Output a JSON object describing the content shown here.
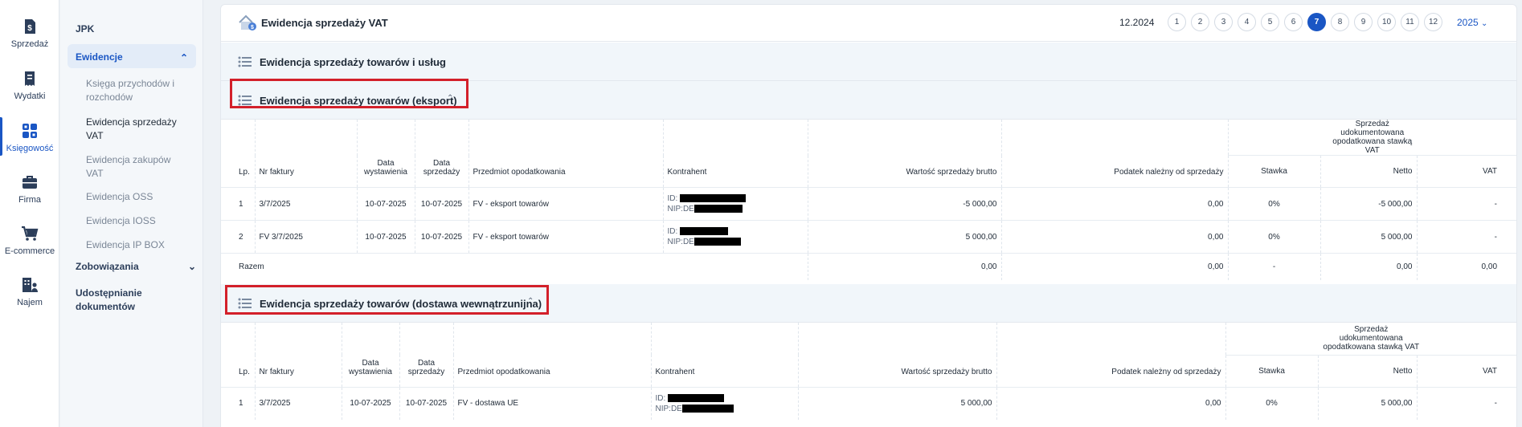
{
  "rail": {
    "items": [
      {
        "label": "Sprzedaż",
        "icon": "dollar-document-icon"
      },
      {
        "label": "Wydatki",
        "icon": "receipt-icon"
      },
      {
        "label": "Księgowość",
        "icon": "grid-icon"
      },
      {
        "label": "Firma",
        "icon": "briefcase-icon"
      },
      {
        "label": "E-commerce",
        "icon": "cart-icon"
      },
      {
        "label": "Najem",
        "icon": "building-user-icon"
      }
    ]
  },
  "subnav": {
    "jpk": "JPK",
    "ewidencje": "Ewidencje",
    "children": [
      "Księga przychodów i rozchodów",
      "Ewidencja sprzedaży VAT",
      "Ewidencja zakupów VAT",
      "Ewidencja OSS",
      "Ewidencja IOSS",
      "Ewidencja IP BOX"
    ],
    "zobowiazania": "Zobowiązania",
    "udostepnianie": "Udostępnianie dokumentów"
  },
  "header": {
    "title": "Ewidencja sprzedaży VAT",
    "period": "12.2024",
    "months": [
      "1",
      "2",
      "3",
      "4",
      "5",
      "6",
      "7",
      "8",
      "9",
      "10",
      "11",
      "12"
    ],
    "selected_month": "7",
    "year": "2025"
  },
  "sections": {
    "s1": {
      "title": "Ewidencja sprzedaży towarów i usług"
    },
    "s2": {
      "title": "Ewidencja sprzedaży towarów (eksport)"
    },
    "s3": {
      "title": "Ewidencja sprzedaży towarów (dostawa wewnątrzunijna)"
    }
  },
  "columns": {
    "lp": "Lp.",
    "nr": "Nr faktury",
    "data_wyst": "Data wystawienia",
    "data_sprz": "Data sprzedaży",
    "przedmiot": "Przedmiot opodatkowania",
    "kontrahent": "Kontrahent",
    "brutto": "Wartość sprzedaży brutto",
    "podatek": "Podatek należny od sprzedaży",
    "group": "Sprzedaż udokumentowana opodatkowana stawką VAT",
    "stawka": "Stawka",
    "netto": "Netto",
    "vat": "VAT"
  },
  "export_rows": [
    {
      "lp": "1",
      "nr": "3/7/2025",
      "data_wyst": "10-07-2025",
      "data_sprz": "10-07-2025",
      "przedmiot": "FV - eksport towarów",
      "id_label": "ID:",
      "nip_label": "NIP:DE",
      "brutto": "-5 000,00",
      "podatek": "0,00",
      "stawka": "0%",
      "netto": "-5 000,00",
      "vat": "-"
    },
    {
      "lp": "2",
      "nr": "FV 3/7/2025",
      "data_wyst": "10-07-2025",
      "data_sprz": "10-07-2025",
      "przedmiot": "FV - eksport towarów",
      "id_label": "ID:",
      "nip_label": "NIP:DE",
      "brutto": "5 000,00",
      "podatek": "0,00",
      "stawka": "0%",
      "netto": "5 000,00",
      "vat": "-"
    }
  ],
  "export_total": {
    "label": "Razem",
    "brutto": "0,00",
    "podatek": "0,00",
    "stawka": "-",
    "netto": "0,00",
    "vat": "0,00"
  },
  "wdt_rows": [
    {
      "lp": "1",
      "nr": "3/7/2025",
      "data_wyst": "10-07-2025",
      "data_sprz": "10-07-2025",
      "przedmiot": "FV - dostawa UE",
      "id_label": "ID:",
      "nip_label": "NIP:DE",
      "brutto": "5 000,00",
      "podatek": "0,00",
      "stawka": "0%",
      "netto": "5 000,00",
      "vat": "-"
    }
  ],
  "colors": {
    "accent": "#1a56c4",
    "highlight": "#d3202a"
  }
}
